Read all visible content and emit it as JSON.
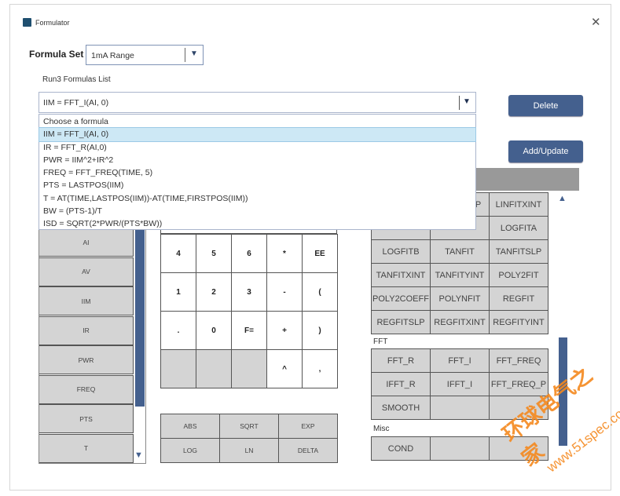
{
  "window": {
    "title": "Formulator",
    "close_icon": "close-icon"
  },
  "formula_set": {
    "label": "Formula Set",
    "value": "1mA Range"
  },
  "formulas_list": {
    "label": "Run3 Formulas List",
    "value": "IIM = FFT_I(AI, 0)",
    "options": [
      "Choose a formula",
      "IIM = FFT_I(AI, 0)",
      "IR = FFT_R(AI,0)",
      "PWR = IIM^2+IR^2",
      "FREQ = FFT_FREQ(TIME, 5)",
      "PTS = LASTPOS(IIM)",
      "T = AT(TIME,LASTPOS(IIM))-AT(TIME,FIRSTPOS(IIM))",
      "BW = (PTS-1)/T",
      "ISD = SQRT(2*PWR/(PTS*BW))"
    ],
    "selected_index": 1
  },
  "buttons": {
    "delete": "Delete",
    "add_update": "Add/Update"
  },
  "variables": [
    "AI",
    "AV",
    "IIM",
    "IR",
    "PWR",
    "FREQ",
    "PTS",
    "T"
  ],
  "keypad": [
    [
      "4",
      "5",
      "6",
      "*",
      "EE"
    ],
    [
      "1",
      "2",
      "3",
      "-",
      "("
    ],
    [
      ".",
      "0",
      "F=",
      "+",
      ")"
    ],
    [
      "",
      "",
      "",
      "^",
      ","
    ]
  ],
  "functions": [
    [
      "ABS",
      "SQRT",
      "EXP"
    ],
    [
      "LOG",
      "LN",
      "DELTA"
    ]
  ],
  "fit_functions": [
    [
      "",
      "LINFITSLP",
      "LINFITXINT"
    ],
    [
      "",
      "",
      "LOGFITA"
    ],
    [
      "LOGFITB",
      "TANFIT",
      "TANFITSLP"
    ],
    [
      "TANFITXINT",
      "TANFITYINT",
      "POLY2FIT"
    ],
    [
      "POLY2COEFF",
      "POLYNFIT",
      "REGFIT"
    ],
    [
      "REGFITSLP",
      "REGFITXINT",
      "REGFITYINT"
    ]
  ],
  "fft": {
    "label": "FFT",
    "items": [
      [
        "FFT_R",
        "FFT_I",
        "FFT_FREQ"
      ],
      [
        "IFFT_R",
        "IFFT_I",
        "FFT_FREQ_P"
      ],
      [
        "SMOOTH",
        "",
        ""
      ]
    ]
  },
  "misc": {
    "label": "Misc",
    "items": [
      [
        "COND",
        "",
        ""
      ]
    ]
  },
  "watermark": {
    "text": "环球电气之家",
    "url": "www.51spec.com"
  },
  "colors": {
    "accent": "#44608e",
    "selected": "#cde8f5",
    "cell": "#d4d4d4",
    "header": "#999999",
    "watermark": "#f5891f"
  }
}
